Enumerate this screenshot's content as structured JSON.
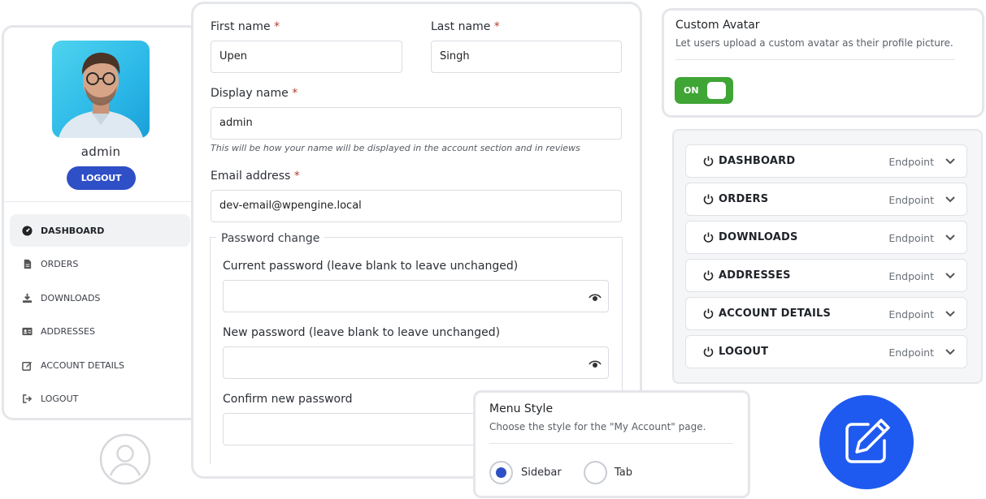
{
  "account": {
    "username": "admin",
    "logout_button": "LOGOUT",
    "nav": [
      {
        "label": "DASHBOARD",
        "icon": "dashboard-icon",
        "active": true
      },
      {
        "label": "ORDERS",
        "icon": "file-icon",
        "active": false
      },
      {
        "label": "DOWNLOADS",
        "icon": "download-icon",
        "active": false
      },
      {
        "label": "ADDRESSES",
        "icon": "id-card-icon",
        "active": false
      },
      {
        "label": "ACCOUNT DETAILS",
        "icon": "edit-icon",
        "active": false
      },
      {
        "label": "LOGOUT",
        "icon": "sign-out-icon",
        "active": false
      }
    ]
  },
  "form": {
    "first_name_label": "First name",
    "first_name_value": "Upen",
    "last_name_label": "Last name",
    "last_name_value": "Singh",
    "display_name_label": "Display name",
    "display_name_value": "admin",
    "display_name_hint": "This will be how your name will be displayed in the account section and in reviews",
    "email_label": "Email address",
    "email_value": "dev-email@wpengine.local",
    "required_mark": "*",
    "password_legend": "Password change",
    "current_password_label": "Current password (leave blank to leave unchanged)",
    "new_password_label": "New password (leave blank to leave unchanged)",
    "confirm_password_label": "Confirm new password"
  },
  "custom_avatar": {
    "title": "Custom Avatar",
    "description": "Let users upload a custom avatar as their profile picture.",
    "toggle_label": "ON",
    "enabled": true,
    "toggle_color": "#3fa535"
  },
  "endpoints": [
    {
      "name": "DASHBOARD",
      "type": "Endpoint"
    },
    {
      "name": "ORDERS",
      "type": "Endpoint"
    },
    {
      "name": "DOWNLOADS",
      "type": "Endpoint"
    },
    {
      "name": "ADDRESSES",
      "type": "Endpoint"
    },
    {
      "name": "ACCOUNT DETAILS",
      "type": "Endpoint"
    },
    {
      "name": "LOGOUT",
      "type": "Endpoint"
    }
  ],
  "menu_style": {
    "title": "Menu Style",
    "description": "Choose the style for the \"My Account\" page.",
    "options": [
      {
        "label": "Sidebar",
        "selected": true
      },
      {
        "label": "Tab",
        "selected": false
      }
    ]
  },
  "colors": {
    "accent": "#2f4fc7",
    "edit_button": "#1f5af0"
  }
}
